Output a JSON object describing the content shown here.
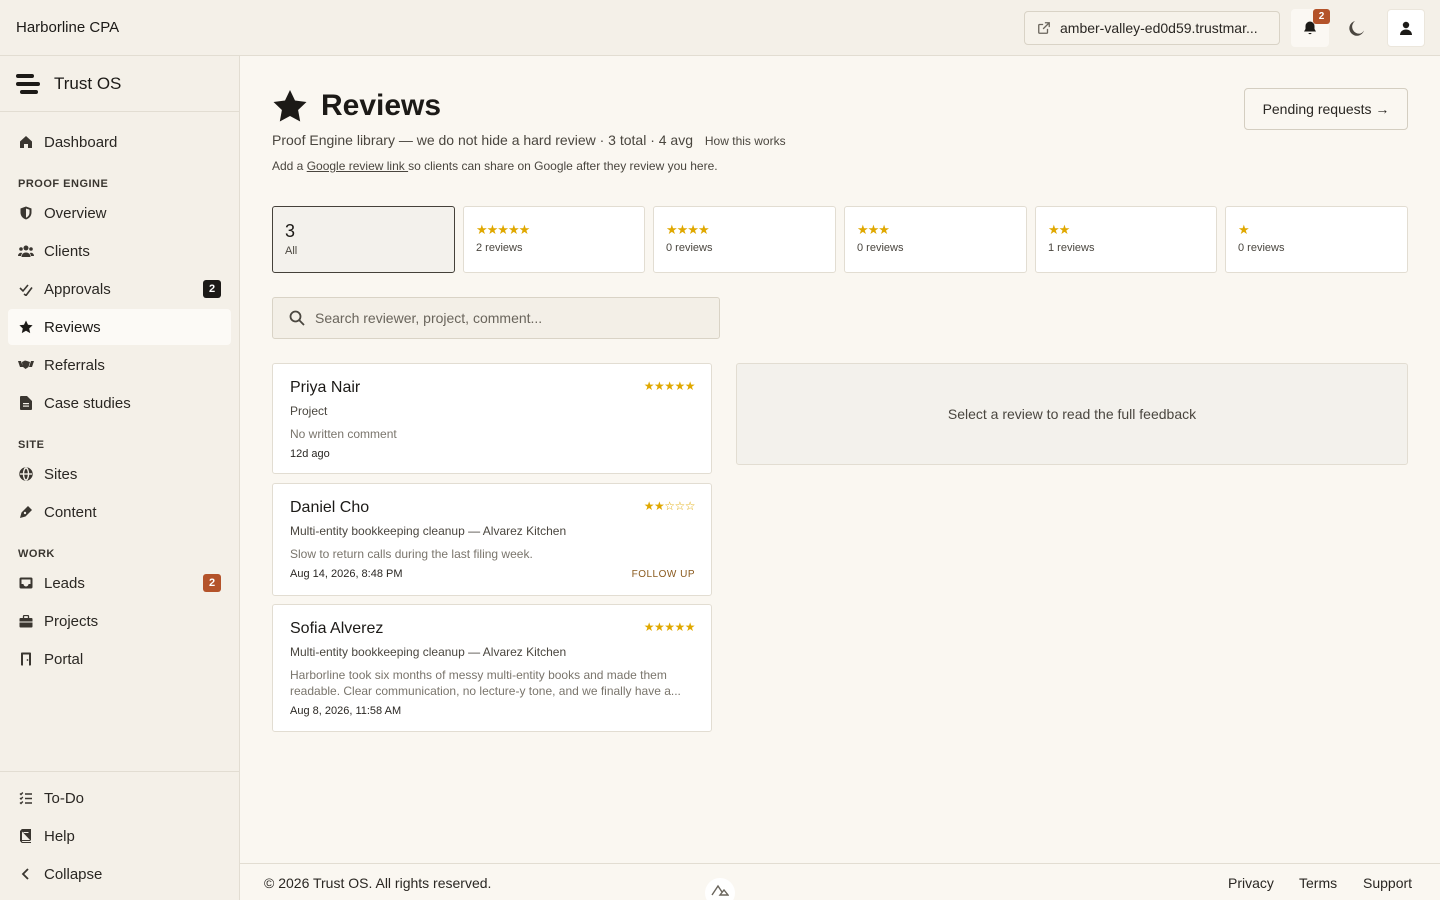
{
  "topbar": {
    "org_name": "Harborline CPA",
    "site_link": "amber-valley-ed0d59.trustmar...",
    "notification_count": "2"
  },
  "sidebar": {
    "brand": "Trust OS",
    "dashboard": "Dashboard",
    "section_proof": "PROOF ENGINE",
    "overview": "Overview",
    "clients": "Clients",
    "approvals": "Approvals",
    "approvals_badge": "2",
    "reviews": "Reviews",
    "referrals": "Referrals",
    "case_studies": "Case studies",
    "section_site": "SITE",
    "sites": "Sites",
    "content": "Content",
    "section_work": "WORK",
    "leads": "Leads",
    "leads_badge": "2",
    "projects": "Projects",
    "portal": "Portal",
    "todo": "To-Do",
    "help": "Help",
    "collapse": "Collapse"
  },
  "header": {
    "title": "Reviews",
    "subtitle": "Proof Engine library — we do not hide a hard review · 3 total · 4 avg",
    "how_link": "How this works",
    "google_prefix": "Add a ",
    "google_link": "Google review link ",
    "google_suffix": "so clients can share on Google after they review you here.",
    "pending_button": "Pending requests →"
  },
  "filters": {
    "all_count": "3",
    "all_label": "All",
    "five_stars": "★★★★★",
    "five_reviews": "2 reviews",
    "four_stars": "★★★★",
    "four_reviews": "0 reviews",
    "three_stars": "★★★",
    "three_reviews": "0 reviews",
    "two_stars": "★★",
    "two_reviews": "1 reviews",
    "one_stars": "★",
    "one_reviews": "0 reviews"
  },
  "search": {
    "placeholder": "Search reviewer, project, comment..."
  },
  "reviews": [
    {
      "name": "Priya Nair",
      "stars": "★★★★★",
      "project": "Project",
      "comment": "No written comment",
      "date": "12d ago"
    },
    {
      "name": "Daniel Cho",
      "stars": "★★☆☆☆",
      "project": "Multi-entity bookkeeping cleanup — Alvarez Kitchen",
      "comment": "Slow to return calls during the last filing week.",
      "date": "Aug 14, 2026, 8:48 PM",
      "follow_up": "FOLLOW UP"
    },
    {
      "name": "Sofia Alverez",
      "stars": "★★★★★",
      "project": "Multi-entity bookkeeping cleanup — Alvarez Kitchen",
      "comment": "Harborline took six months of messy multi-entity books and made them readable. Clear communication, no lecture-y tone, and we finally have a...",
      "date": "Aug 8, 2026, 11:58 AM"
    }
  ],
  "detail": {
    "empty_message": "Select a review to read the full feedback"
  },
  "footer": {
    "copyright": "© 2026 Trust OS. All rights reserved.",
    "privacy": "Privacy",
    "terms": "Terms",
    "support": "Support"
  },
  "colors": {
    "accent_star": "#e0a800",
    "badge_rust": "#b4532a",
    "badge_dark": "#1c1a17",
    "background": "#faf7f1",
    "sidebar": "#f4f0e8"
  }
}
